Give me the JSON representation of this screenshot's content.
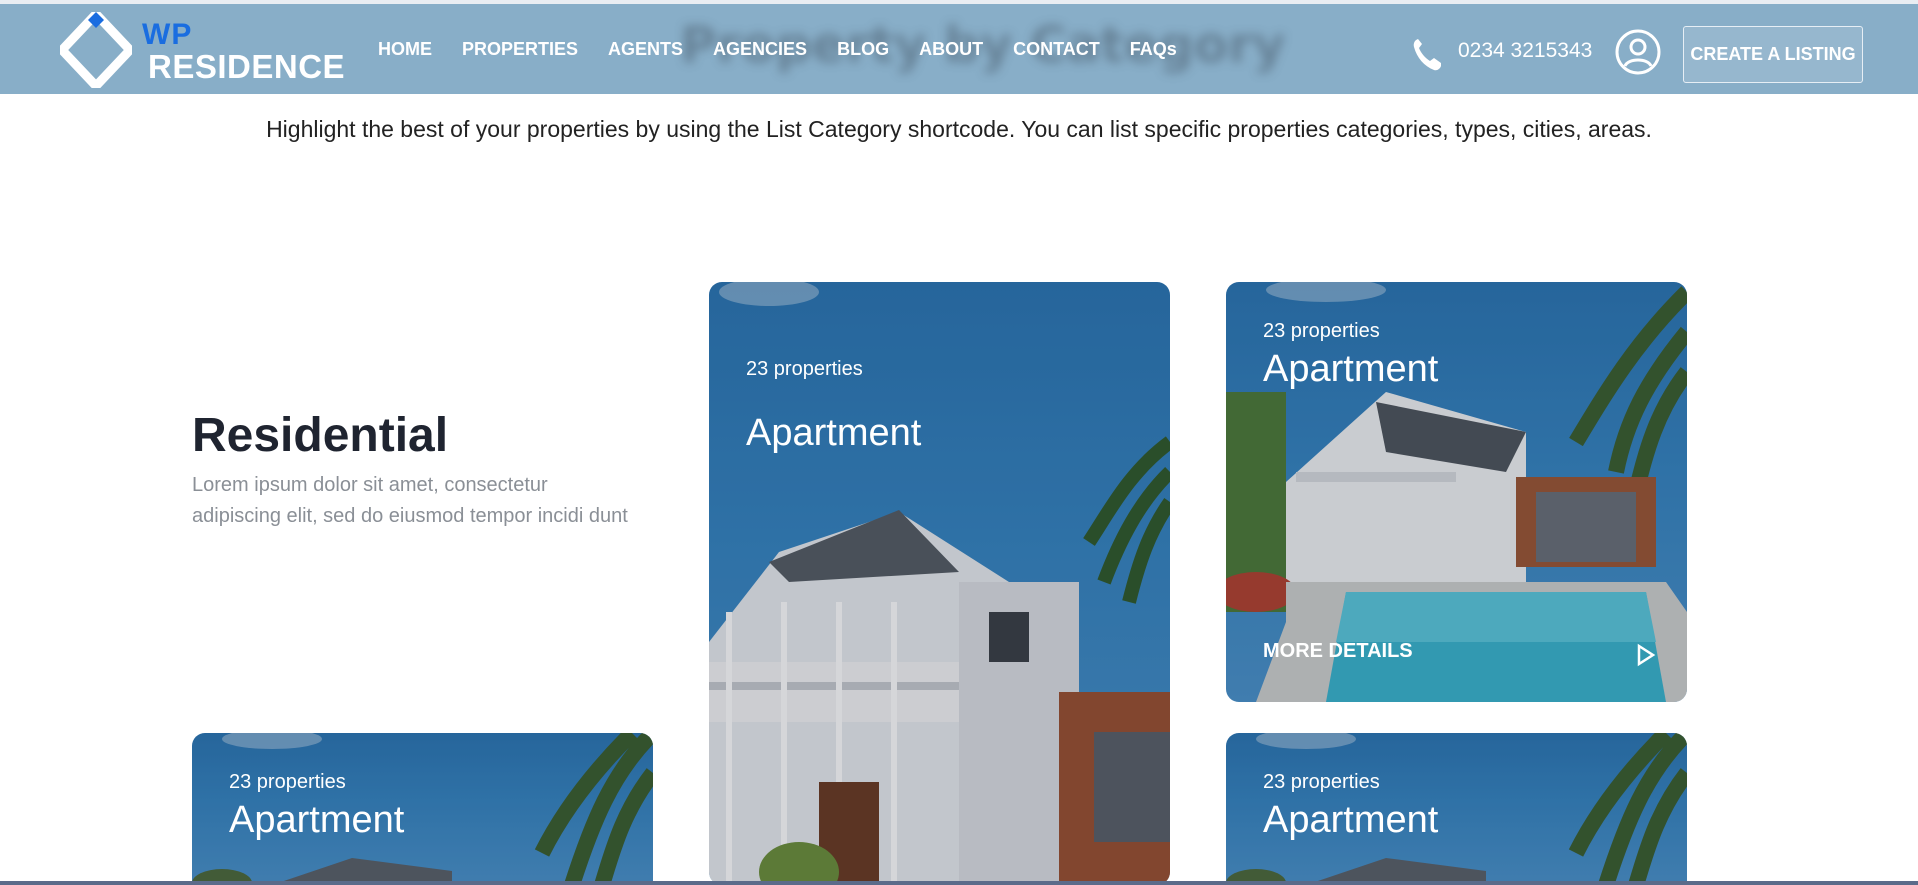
{
  "header": {
    "ghost_title": "Property by Category",
    "logo": {
      "line1": "WP",
      "line2": "RESIDENCE"
    },
    "nav": [
      "HOME",
      "PROPERTIES",
      "AGENTS",
      "AGENCIES",
      "BLOG",
      "ABOUT",
      "CONTACT",
      "FAQs"
    ],
    "phone": "0234 3215343",
    "cta_label": "CREATE A LISTING"
  },
  "intro": "Highlight the best of your properties by using the List Category shortcode. You can list specific properties categories, types, cities, areas.",
  "section": {
    "title": "Residential",
    "description": "Lorem ipsum dolor sit amet, consectetur adipiscing elit, sed do eiusmod tempor incidi dunt"
  },
  "cards": [
    {
      "count": "23 properties",
      "title": "Apartment"
    },
    {
      "count": "23 properties",
      "title": "Apartment",
      "more": "MORE DETAILS"
    },
    {
      "count": "23 properties",
      "title": "Apartment"
    },
    {
      "count": "23 properties",
      "title": "Apartment"
    }
  ],
  "colors": {
    "header_bg": "#88aec8",
    "logo_blue": "#1a6de0",
    "card_sky": "#2f7dbd"
  },
  "icons": [
    "logo-diamond-icon",
    "phone-icon",
    "user-icon",
    "play-arrow-icon"
  ]
}
